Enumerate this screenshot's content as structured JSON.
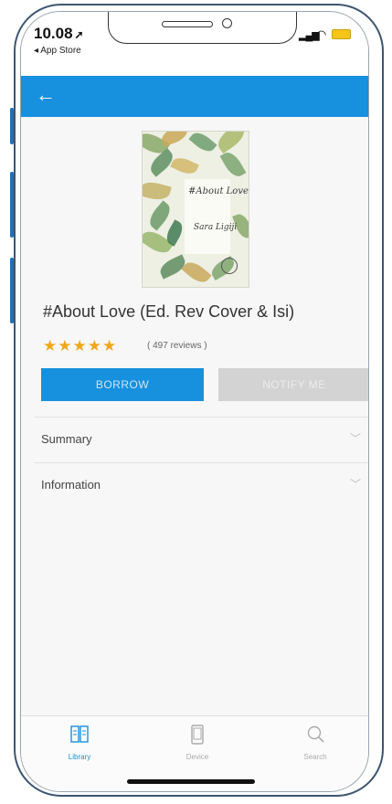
{
  "status_bar": {
    "time": "10.08",
    "back_app": "◂ App Store"
  },
  "header": {
    "back_icon": "arrow-left-icon"
  },
  "book": {
    "cover_title": "#About Love",
    "cover_author": "Sara Ligiji",
    "title": "#About Love (Ed. Rev Cover & Isi)",
    "rating_stars": 5,
    "stars_text": "★★★★★",
    "reviews": "( 497 reviews )"
  },
  "actions": {
    "borrow_label": "BORROW",
    "notify_label": "NOTIFY ME"
  },
  "sections": [
    {
      "label": "Summary"
    },
    {
      "label": "Information"
    }
  ],
  "tabs": [
    {
      "label": "Library",
      "icon": "book-open-icon",
      "active": true
    },
    {
      "label": "Device",
      "icon": "phone-device-icon",
      "active": false
    },
    {
      "label": "Search",
      "icon": "search-icon",
      "active": false
    }
  ],
  "colors": {
    "accent": "#1790dd",
    "star": "#f0a81a",
    "disabled": "#d3d3d3",
    "frame": "#3d5670"
  }
}
